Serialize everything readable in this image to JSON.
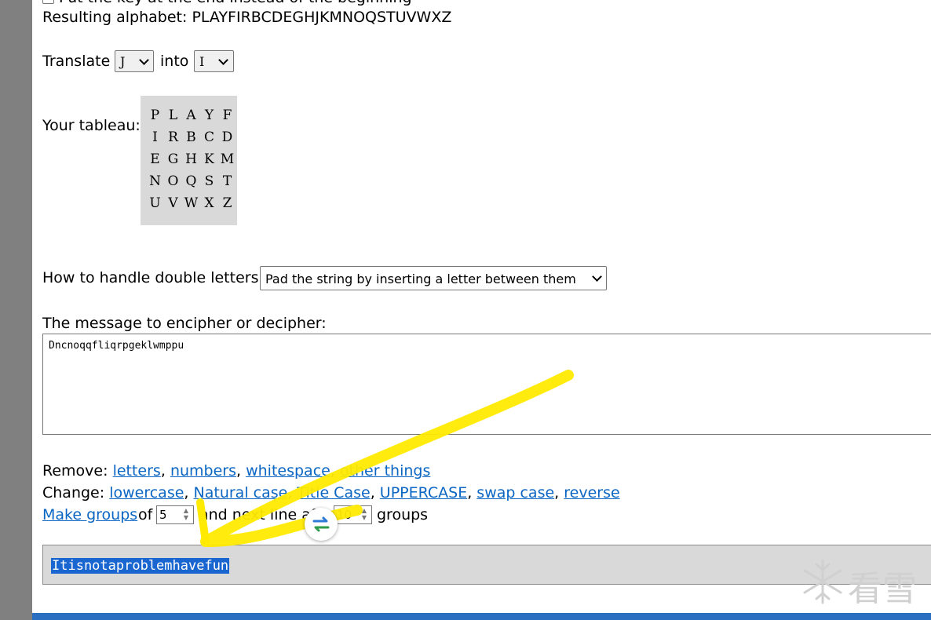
{
  "header": {
    "cutoff_text": "Put the key at the end instead of the beginning",
    "resulting_alphabet_label": "Resulting alphabet:",
    "resulting_alphabet_value": "PLAYFIRBCDEGHJKMNOQSTUVWXZ"
  },
  "translate": {
    "label": "Translate",
    "from_value": "J",
    "into_label": "into",
    "to_value": "I"
  },
  "tableau": {
    "label": "Your tableau:",
    "rows": [
      [
        "P",
        "L",
        "A",
        "Y",
        "F"
      ],
      [
        "I",
        "R",
        "B",
        "C",
        "D"
      ],
      [
        "E",
        "G",
        "H",
        "K",
        "M"
      ],
      [
        "N",
        "O",
        "Q",
        "S",
        "T"
      ],
      [
        "U",
        "V",
        "W",
        "X",
        "Z"
      ]
    ]
  },
  "double_letters": {
    "label": "How to handle double letters:",
    "selected": "Pad the string by inserting a letter between them"
  },
  "message": {
    "label": "The message to encipher or decipher:",
    "value": "Dncnoqqfliqrpgeklwmppu"
  },
  "remove": {
    "label": "Remove:",
    "links": [
      "letters",
      "numbers",
      "whitespace",
      "other things"
    ]
  },
  "change": {
    "label": "Change:",
    "links": [
      "lowercase",
      "Natural case",
      "Title Case",
      "UPPERCASE",
      "swap case",
      "reverse"
    ]
  },
  "groups": {
    "link": "Make groups",
    "of_label": "of",
    "group_size": "5",
    "next_line_label": "and next line after",
    "line_groups": "10",
    "groups_label": "groups"
  },
  "output": {
    "value": "Itisnotaproblemhavefun"
  },
  "colors": {
    "link": "#0b66c3",
    "highlight": "#ffea00",
    "selection": "#1a66d0",
    "bottom_bar": "#2a6fc0"
  },
  "icons": {
    "float_button": "swap-arrows-icon",
    "watermark": "snowflake-icon"
  },
  "watermark_text": "看雪"
}
